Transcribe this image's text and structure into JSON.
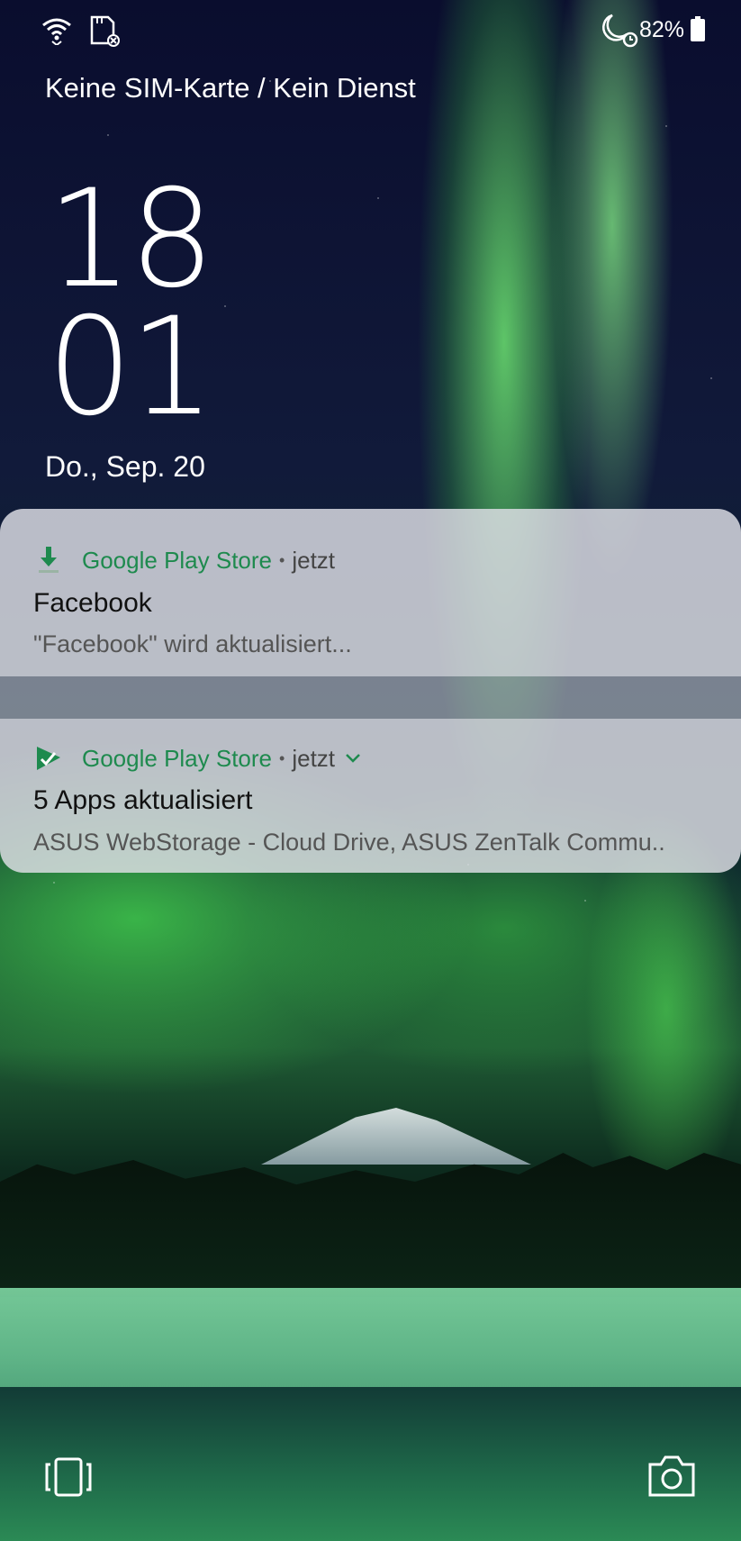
{
  "status_bar": {
    "battery": "82%",
    "icons": [
      "wifi-icon",
      "sd-card-icon",
      "do-not-disturb-icon",
      "alarm-icon",
      "battery-icon"
    ]
  },
  "lockscreen": {
    "carrier": "Keine SIM-Karte / Kein Dienst",
    "clock_hour": "18",
    "clock_minute": "01",
    "date": "Do., Sep. 20"
  },
  "notifications": [
    {
      "app": "Google Play Store",
      "time": "jetzt",
      "title": "Facebook",
      "text": "\"Facebook\" wird aktualisiert...",
      "icon": "download-icon"
    },
    {
      "app": "Google Play Store",
      "time": "jetzt",
      "title": "5 Apps aktualisiert",
      "text": "ASUS WebStorage - Cloud Drive, ASUS ZenTalk Commu..",
      "icon": "update-done-icon"
    }
  ],
  "shortcuts": [
    "multitask-icon",
    "camera-icon"
  ],
  "colors": {
    "app_name": "#1e8a4e",
    "card": "#e1e1e8"
  }
}
